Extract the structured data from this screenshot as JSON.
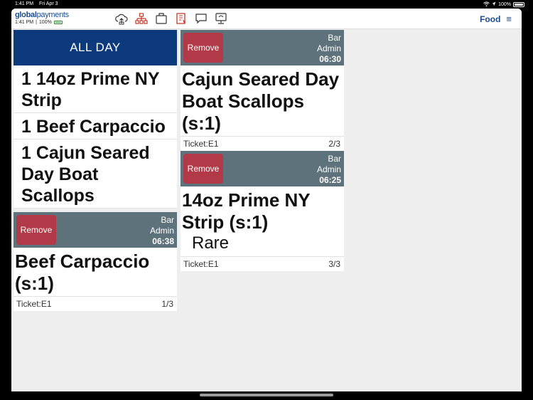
{
  "status_bar": {
    "time": "1:41 PM",
    "date": "Fri Apr 3",
    "battery": "100%"
  },
  "header": {
    "brand_a": "global",
    "brand_b": "payments",
    "device_time": "1:41 PM",
    "device_battery": "100%",
    "toolbar_icons": [
      "cloud-upload-icon",
      "network-icon",
      "inbox-icon",
      "receipt-icon",
      "message-icon",
      "terminal-icon"
    ],
    "section": "Food"
  },
  "all_day": {
    "title": "ALL DAY",
    "items": [
      "1  14oz Prime NY Strip",
      "1  Beef Carpaccio",
      "1  Cajun Seared Day Boat Scallops"
    ]
  },
  "tickets": [
    {
      "remove_label": "Remove",
      "station": "Bar",
      "server": "Admin",
      "time": "06:38",
      "item": "Beef Carpaccio (s:1)",
      "modifier": "",
      "ticket": "Ticket:E1",
      "count": "1/3"
    },
    {
      "remove_label": "Remove",
      "station": "Bar",
      "server": "Admin",
      "time": "06:30",
      "item": "Cajun Seared Day Boat Scallops (s:1)",
      "modifier": "",
      "ticket": "Ticket:E1",
      "count": "2/3"
    },
    {
      "remove_label": "Remove",
      "station": "Bar",
      "server": "Admin",
      "time": "06:25",
      "item": "14oz Prime NY Strip (s:1)",
      "modifier": "Rare",
      "ticket": "Ticket:E1",
      "count": "3/3"
    }
  ],
  "colors": {
    "brand_blue": "#0d3a7d",
    "card_header": "#5e727c",
    "remove_red": "#b23a48"
  }
}
